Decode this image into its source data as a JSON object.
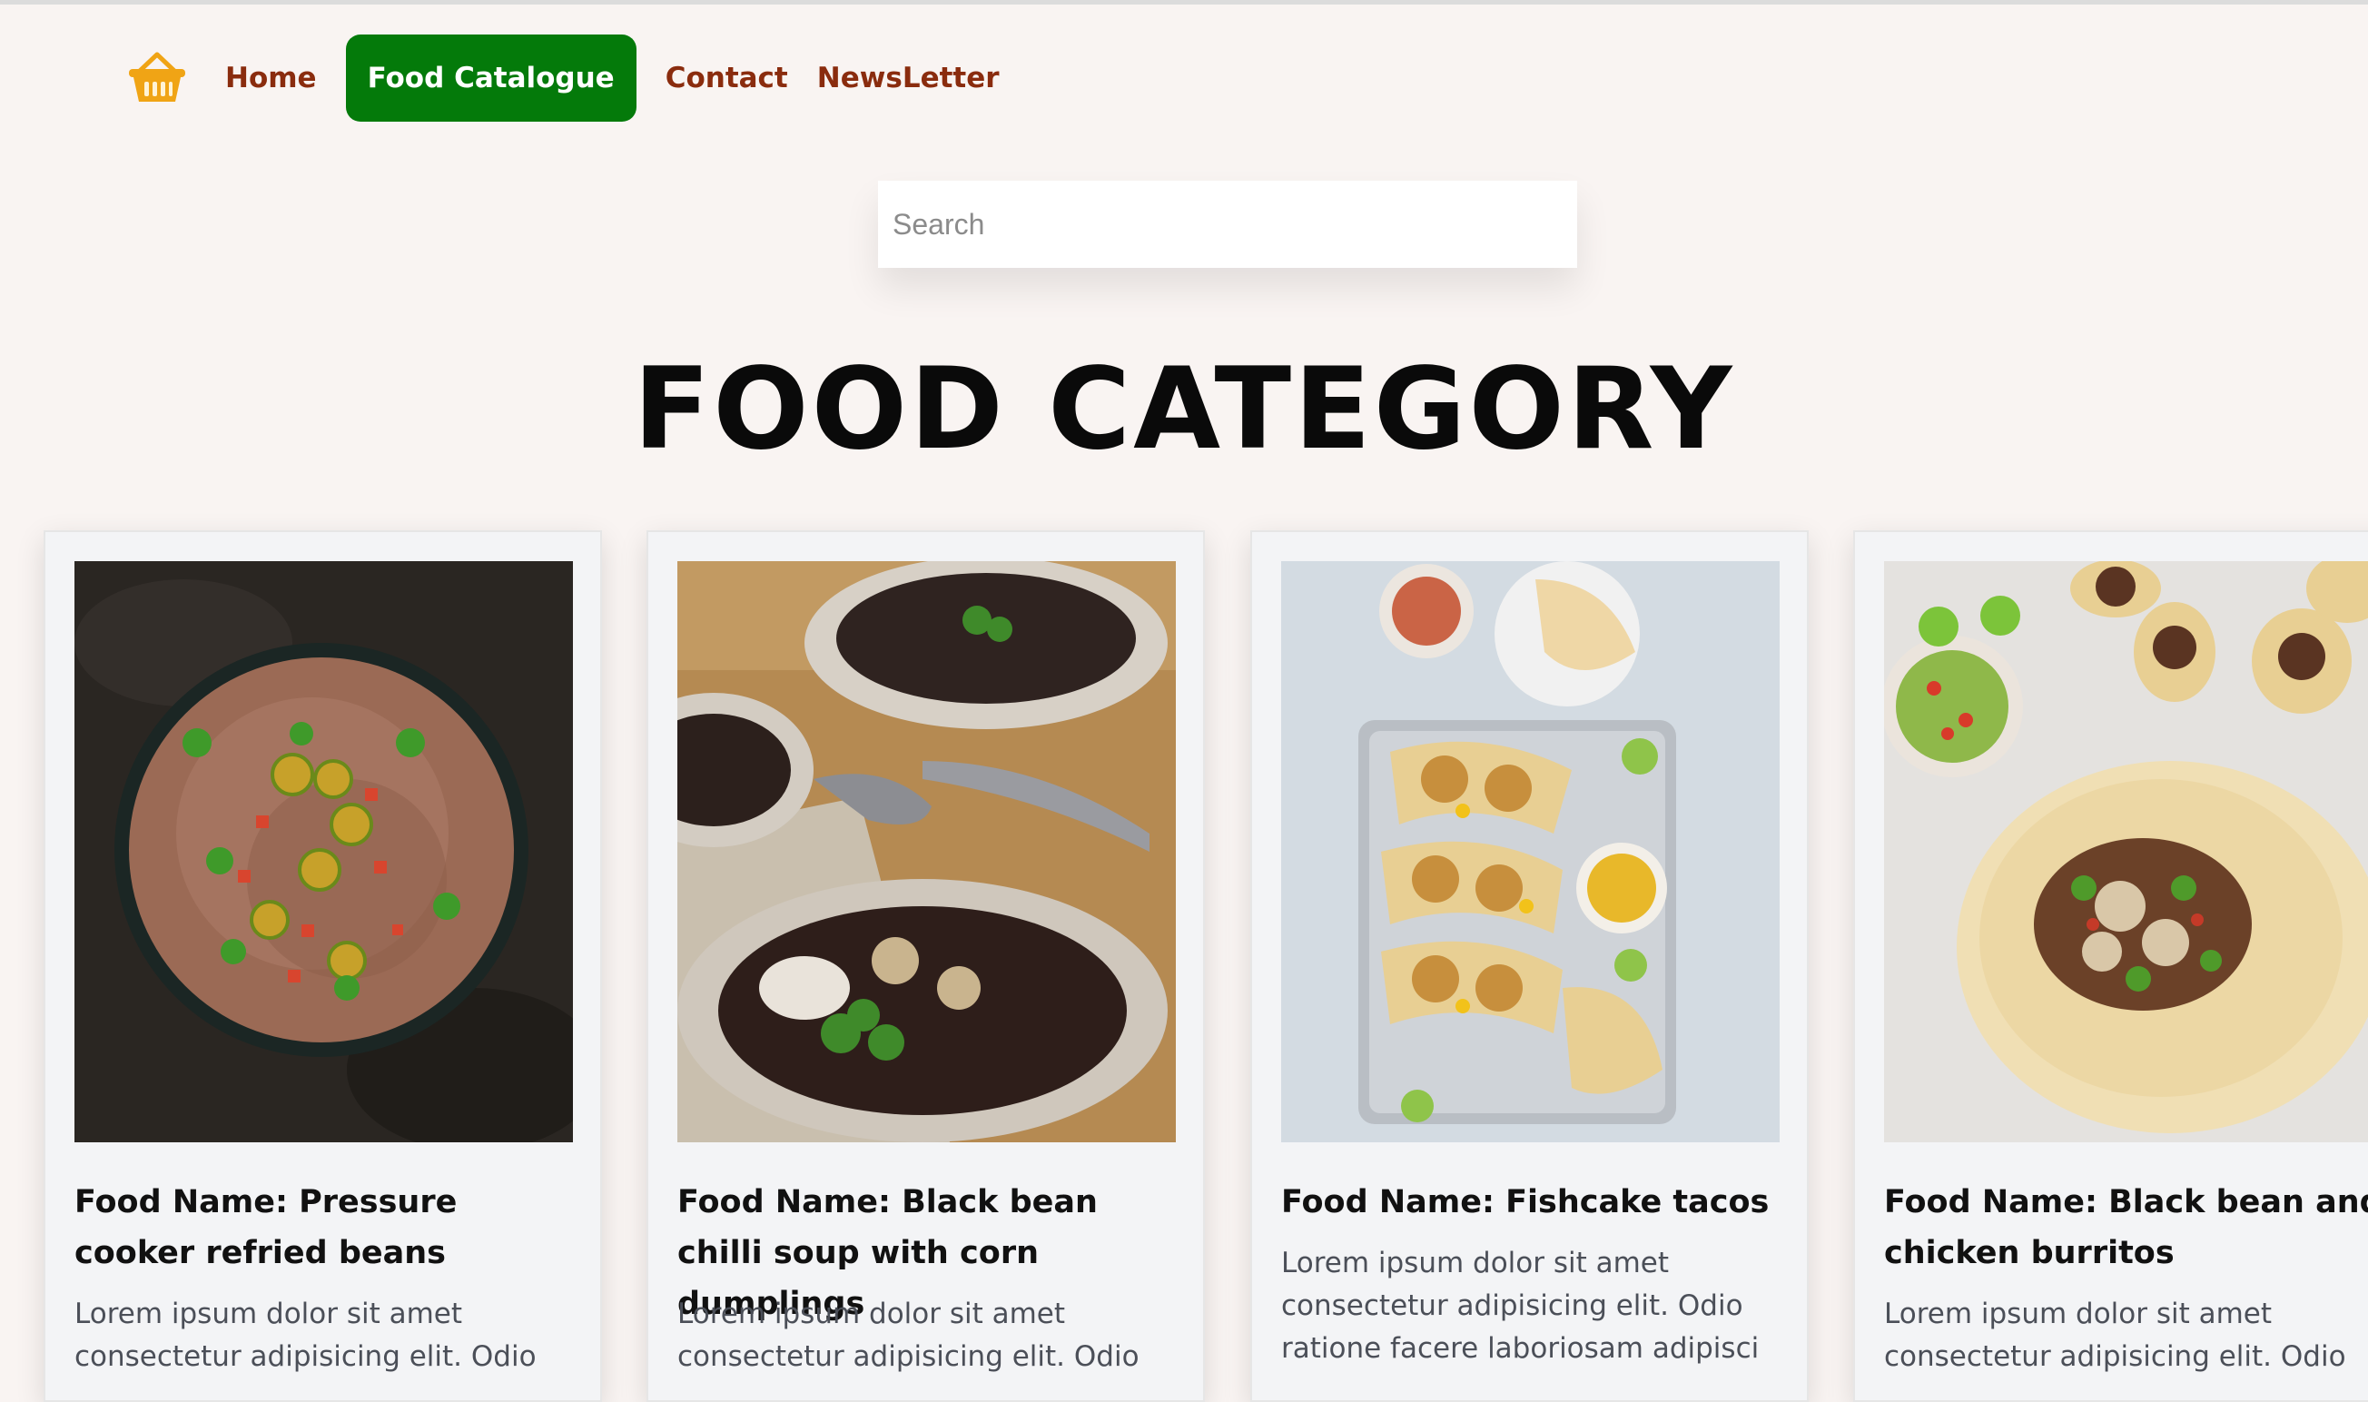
{
  "nav": {
    "logo_icon": "basket-icon",
    "items": [
      {
        "label": "Home",
        "active": false
      },
      {
        "label": "Food Catalogue",
        "active": true
      },
      {
        "label": "Contact",
        "active": false
      },
      {
        "label": "NewsLetter",
        "active": false
      }
    ],
    "active_color": "#047a0a",
    "link_color": "#8a2c0e"
  },
  "search": {
    "placeholder": "Search",
    "value": ""
  },
  "page_title": "FOOD CATEGORY",
  "cards": [
    {
      "name": "Food Name: Pressure cooker refried beans",
      "description": "Lorem ipsum dolor sit amet consectetur adipisicing elit. Odio",
      "image_icon": "refried-beans-image"
    },
    {
      "name": "Food Name: Black bean chilli soup with corn dumplings",
      "description": "Lorem ipsum dolor sit amet consectetur adipisicing elit. Odio",
      "image_icon": "black-bean-soup-image"
    },
    {
      "name": "Food Name: Fishcake tacos",
      "description": "Lorem ipsum dolor sit amet consectetur adipisicing elit. Odio ratione facere laboriosam adipisci",
      "image_icon": "fishcake-tacos-image"
    },
    {
      "name": "Food Name: Black bean and chicken burritos",
      "description": "Lorem ipsum dolor sit amet consectetur adipisicing elit. Odio",
      "image_icon": "burritos-image"
    }
  ]
}
